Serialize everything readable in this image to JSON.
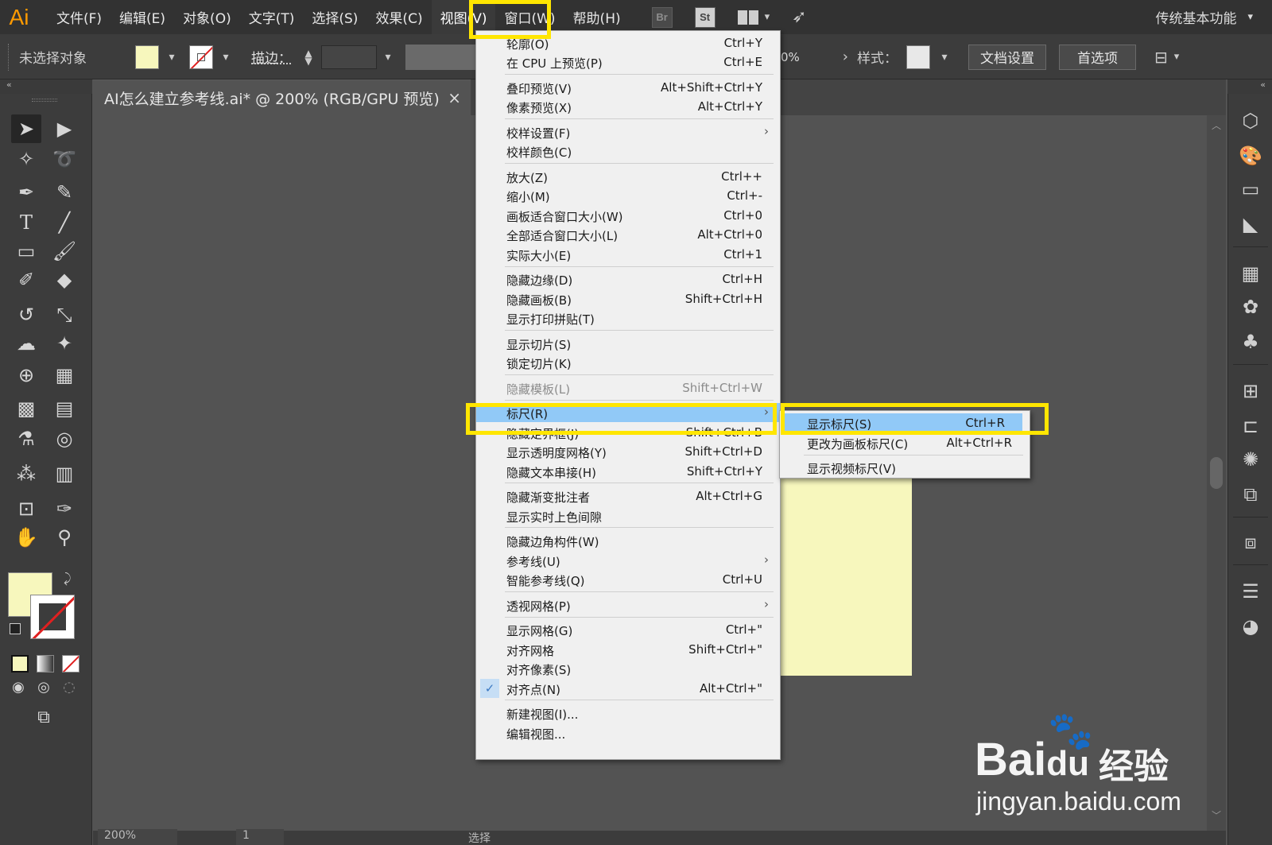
{
  "app": {
    "logo": "Ai"
  },
  "menubar": {
    "items": [
      "文件(F)",
      "编辑(E)",
      "对象(O)",
      "文字(T)",
      "选择(S)",
      "效果(C)",
      "视图(V)",
      "窗口(W)",
      "帮助(H)"
    ],
    "badges": {
      "br": "Br",
      "st": "St"
    },
    "workspace": "传统基本功能"
  },
  "controlbar": {
    "selection_label": "未选择对象",
    "stroke_label": "描边：",
    "opacity_value": "0%",
    "style_label": "样式：",
    "doc_setup": "文档设置",
    "preferences": "首选项"
  },
  "document": {
    "tab_title": "AI怎么建立参考线.ai* @ 200% (RGB/GPU 预览)",
    "close": "×",
    "artboard_color": "#f7f7bd"
  },
  "statusbar": {
    "zoom": "200%",
    "page": "1",
    "selection": "选择"
  },
  "view_menu": {
    "items": [
      {
        "label": "轮廓(O)",
        "shortcut": "Ctrl+Y"
      },
      {
        "label": "在 CPU 上预览(P)",
        "shortcut": "Ctrl+E"
      },
      {
        "label": "叠印预览(V)",
        "shortcut": "Alt+Shift+Ctrl+Y"
      },
      {
        "label": "像素预览(X)",
        "shortcut": "Alt+Ctrl+Y"
      },
      {
        "label": "校样设置(F)",
        "shortcut": ""
      },
      {
        "label": "校样颜色(C)",
        "shortcut": ""
      },
      {
        "label": "放大(Z)",
        "shortcut": "Ctrl++"
      },
      {
        "label": "缩小(M)",
        "shortcut": "Ctrl+-"
      },
      {
        "label": "画板适合窗口大小(W)",
        "shortcut": "Ctrl+0"
      },
      {
        "label": "全部适合窗口大小(L)",
        "shortcut": "Alt+Ctrl+0"
      },
      {
        "label": "实际大小(E)",
        "shortcut": "Ctrl+1"
      },
      {
        "label": "隐藏边缘(D)",
        "shortcut": "Ctrl+H"
      },
      {
        "label": "隐藏画板(B)",
        "shortcut": "Shift+Ctrl+H"
      },
      {
        "label": "显示打印拼贴(T)",
        "shortcut": ""
      },
      {
        "label": "显示切片(S)",
        "shortcut": ""
      },
      {
        "label": "锁定切片(K)",
        "shortcut": ""
      },
      {
        "label": "隐藏模板(L)",
        "shortcut": "Shift+Ctrl+W"
      },
      {
        "label": "标尺(R)",
        "shortcut": ""
      },
      {
        "label": "隐藏定界框(J)",
        "shortcut": "Shift+Ctrl+B"
      },
      {
        "label": "显示透明度网格(Y)",
        "shortcut": "Shift+Ctrl+D"
      },
      {
        "label": "隐藏文本串接(H)",
        "shortcut": "Shift+Ctrl+Y"
      },
      {
        "label": "隐藏渐变批注者",
        "shortcut": "Alt+Ctrl+G"
      },
      {
        "label": "显示实时上色间隙",
        "shortcut": ""
      },
      {
        "label": "隐藏边角构件(W)",
        "shortcut": ""
      },
      {
        "label": "参考线(U)",
        "shortcut": ""
      },
      {
        "label": "智能参考线(Q)",
        "shortcut": "Ctrl+U"
      },
      {
        "label": "透视网格(P)",
        "shortcut": ""
      },
      {
        "label": "显示网格(G)",
        "shortcut": "Ctrl+\""
      },
      {
        "label": "对齐网格",
        "shortcut": "Shift+Ctrl+\""
      },
      {
        "label": "对齐像素(S)",
        "shortcut": ""
      },
      {
        "label": "对齐点(N)",
        "shortcut": "Alt+Ctrl+\""
      },
      {
        "label": "新建视图(I)...",
        "shortcut": ""
      },
      {
        "label": "编辑视图...",
        "shortcut": ""
      }
    ],
    "submenu_arrow": "›",
    "check": "✓"
  },
  "ruler_submenu": {
    "items": [
      {
        "label": "显示标尺(S)",
        "shortcut": "Ctrl+R"
      },
      {
        "label": "更改为画板标尺(C)",
        "shortcut": "Alt+Ctrl+R"
      },
      {
        "label": "显示视频标尺(V)",
        "shortcut": ""
      }
    ]
  },
  "watermark": {
    "brand": "Bai",
    "brand_suffix": "du",
    "cn": "经验",
    "url": "jingyan.baidu.com"
  },
  "colors": {
    "highlight_box": "#ffe600",
    "menu_highlight": "#91c9f7",
    "fill": "#f7f7bd",
    "stroke_none": "#e02020"
  },
  "icons": [
    "selection-tool-icon",
    "direct-selection-icon",
    "magic-wand-icon",
    "lasso-icon",
    "pen-icon",
    "curvature-icon",
    "type-icon",
    "line-icon",
    "rectangle-icon",
    "paintbrush-icon",
    "shaper-icon",
    "eraser-icon",
    "rotate-icon",
    "scale-icon",
    "warp-icon",
    "puppet-warp-icon",
    "shape-builder-icon",
    "perspective-grid-icon",
    "mesh-icon",
    "gradient-icon",
    "eyedropper-icon",
    "blend-icon",
    "symbol-sprayer-icon",
    "column-graph-icon",
    "artboard-icon",
    "slice-icon",
    "hand-icon",
    "zoom-icon"
  ]
}
